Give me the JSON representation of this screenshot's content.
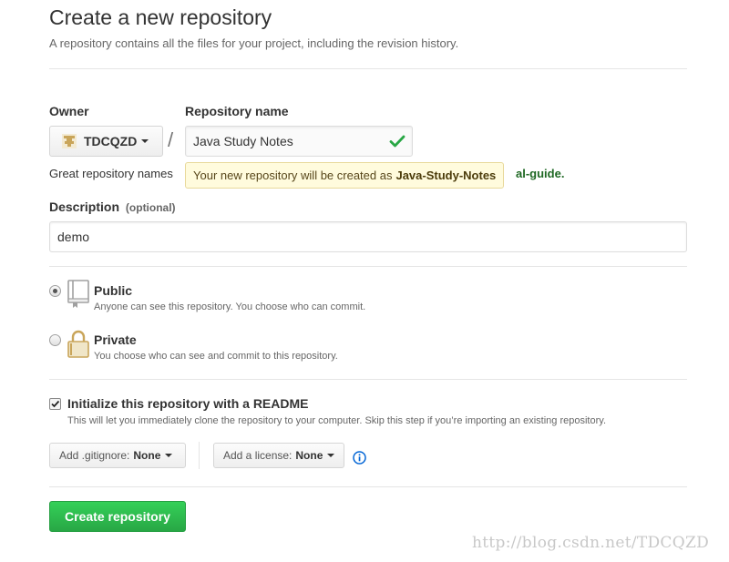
{
  "header": {
    "title": "Create a new repository",
    "subtitle": "A repository contains all the files for your project, including the revision history."
  },
  "owner": {
    "label": "Owner",
    "value": "TDCQZD",
    "icon": "avatar-icon"
  },
  "separator": "/",
  "repo_name": {
    "label": "Repository name",
    "value": "Java Study Notes",
    "status_icon": "check-icon",
    "status_color": "#28a745"
  },
  "name_hint": {
    "prefix": "Great repository names",
    "suffix": "al-guide."
  },
  "tooltip": {
    "text": "Your new repository will be created as",
    "slug": "Java-Study-Notes"
  },
  "description": {
    "label": "Description",
    "optional": "(optional)",
    "value": "demo"
  },
  "visibility": {
    "selected": "public",
    "public": {
      "title": "Public",
      "note": "Anyone can see this repository. You choose who can commit.",
      "icon": "repo-book-icon"
    },
    "private": {
      "title": "Private",
      "note": "You choose who can see and commit to this repository.",
      "icon": "lock-icon"
    }
  },
  "init_readme": {
    "checked": true,
    "label": "Initialize this repository with a README",
    "note": "This will let you immediately clone the repository to your computer. Skip this step if you’re importing an existing repository."
  },
  "gitignore": {
    "label": "Add .gitignore:",
    "value": "None"
  },
  "license": {
    "label": "Add a license:",
    "value": "None",
    "info_icon": "info-icon"
  },
  "submit": {
    "label": "Create repository",
    "color": "#28a745"
  },
  "watermark": "http://blog.csdn.net/TDCQZD"
}
